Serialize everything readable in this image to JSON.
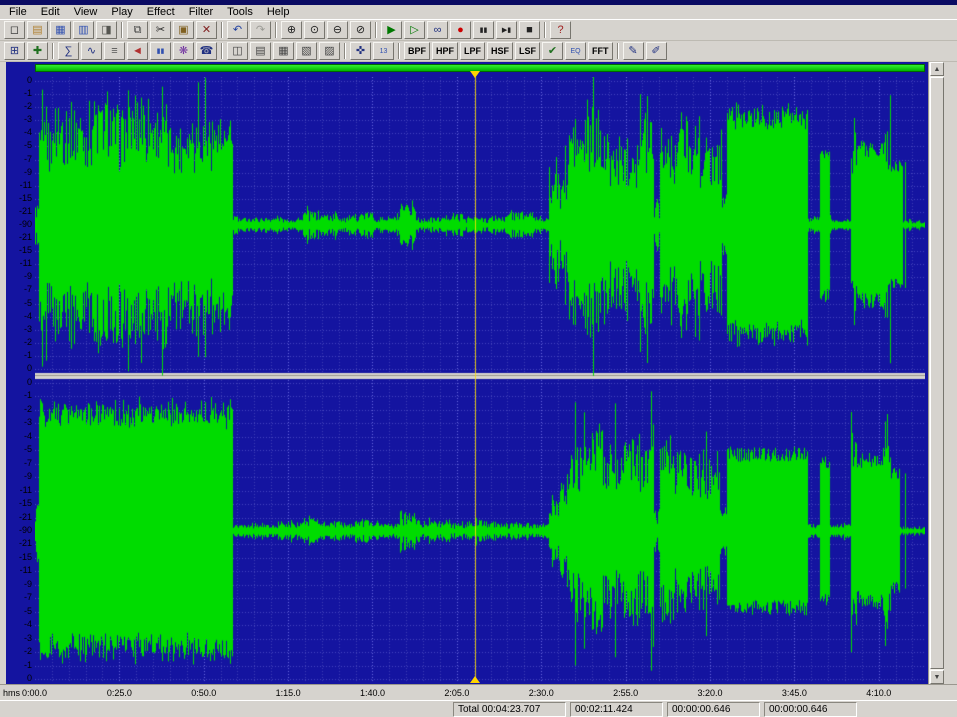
{
  "menu": {
    "items": [
      "File",
      "Edit",
      "View",
      "Play",
      "Effect",
      "Filter",
      "Tools",
      "Help"
    ]
  },
  "toolbar1": {
    "groups": [
      [
        {
          "n": "new",
          "g": "◻"
        },
        {
          "n": "open",
          "g": "▤",
          "c": "#b08030"
        },
        {
          "n": "save",
          "g": "▦",
          "c": "#3050b0"
        },
        {
          "n": "save-as",
          "g": "▥",
          "c": "#3050b0"
        },
        {
          "n": "file-info",
          "g": "◨",
          "c": "#555550"
        }
      ],
      [
        {
          "n": "copy",
          "g": "⧉",
          "c": "#444"
        },
        {
          "n": "cut",
          "g": "✂"
        },
        {
          "n": "paste",
          "g": "▣",
          "c": "#806020"
        },
        {
          "n": "delete",
          "g": "✕",
          "c": "#802020"
        }
      ],
      [
        {
          "n": "undo",
          "g": "↶",
          "c": "#2040a0"
        },
        {
          "n": "redo",
          "g": "↷",
          "c": "#9a9a94"
        }
      ],
      [
        {
          "n": "zoom-in",
          "g": "⊕"
        },
        {
          "n": "zoom-normal",
          "g": "⊙"
        },
        {
          "n": "zoom-out",
          "g": "⊖"
        },
        {
          "n": "zoom-selection",
          "g": "⊘"
        }
      ],
      [
        {
          "n": "play",
          "g": "▶",
          "c": "#007800"
        },
        {
          "n": "play-all",
          "g": "▷",
          "c": "#007800"
        },
        {
          "n": "loop",
          "g": "∞",
          "c": "#203080"
        },
        {
          "n": "record",
          "g": "●",
          "c": "#cc0000"
        },
        {
          "n": "pause",
          "g": "▮▮",
          "sm": true
        },
        {
          "n": "play-next",
          "g": "▶▮",
          "sm": true
        },
        {
          "n": "stop",
          "g": "■"
        }
      ],
      [
        {
          "n": "help-book",
          "g": "?",
          "c": "#a02020"
        }
      ]
    ]
  },
  "toolbar2": {
    "items": [
      {
        "n": "fit-window",
        "g": "⊞",
        "c": "#203080"
      },
      {
        "n": "marker-tool",
        "g": "✚",
        "c": "#207020"
      },
      {
        "sep": true
      },
      {
        "n": "statistics",
        "g": "∑",
        "c": "#203080"
      },
      {
        "n": "waveform-view",
        "g": "∿",
        "c": "#203080"
      },
      {
        "n": "device-controls",
        "g": "≡",
        "c": "#555"
      },
      {
        "n": "speaker",
        "g": "◄",
        "c": "#b03030"
      },
      {
        "n": "level-meters",
        "g": "▮▮",
        "c": "#3050b0",
        "sm": true
      },
      {
        "n": "effects-chain",
        "g": "❋",
        "c": "#7030a0"
      },
      {
        "n": "phone",
        "g": "☎",
        "c": "#203080"
      },
      {
        "sep": true
      },
      {
        "n": "control-window",
        "g": "◫",
        "c": "#444"
      },
      {
        "n": "expression-window",
        "g": "▤",
        "c": "#444"
      },
      {
        "n": "spectrum-window",
        "g": "▦",
        "c": "#444"
      },
      {
        "n": "bars-window",
        "g": "▧",
        "c": "#444"
      },
      {
        "n": "status-window",
        "g": "▨",
        "c": "#444"
      },
      {
        "sep": true
      },
      {
        "n": "snap-cursor",
        "g": "✜",
        "c": "#203080"
      },
      {
        "n": "channel-13",
        "g": "13",
        "c": "#3050b0",
        "sm": true
      },
      {
        "sep": true
      },
      {
        "n": "bpf-filter",
        "t": "BPF"
      },
      {
        "n": "hpf-filter",
        "t": "HPF"
      },
      {
        "n": "lpf-filter",
        "t": "LPF"
      },
      {
        "n": "hsf-filter",
        "t": "HSF"
      },
      {
        "n": "lsf-filter",
        "t": "LSF"
      },
      {
        "n": "noise-reduction",
        "g": "✔",
        "c": "#207020"
      },
      {
        "n": "equalizer",
        "g": "EQ",
        "c": "#3050b0",
        "sm": true
      },
      {
        "n": "fft-filter",
        "t": "FFT"
      },
      {
        "sep": true
      },
      {
        "n": "draw-wave",
        "g": "✎",
        "c": "#203080"
      },
      {
        "n": "draw-envelope",
        "g": "✐",
        "c": "#203080"
      }
    ]
  },
  "ruler": {
    "db_labels": [
      "0",
      "-1",
      "-2",
      "-3",
      "-4",
      "-5",
      "-7",
      "-9",
      "-11",
      "-15",
      "-21",
      "-90",
      "-21",
      "-15",
      "-11",
      "-9",
      "-7",
      "-5",
      "-4",
      "-3",
      "-2",
      "-1",
      "0"
    ]
  },
  "time_ruler": {
    "unit": "hms",
    "labels": [
      {
        "s": 0,
        "text": "0:00.0"
      },
      {
        "s": 25,
        "text": "0:25.0"
      },
      {
        "s": 50,
        "text": "0:50.0"
      },
      {
        "s": 75,
        "text": "1:15.0"
      },
      {
        "s": 100,
        "text": "1:40.0"
      },
      {
        "s": 125,
        "text": "2:05.0"
      },
      {
        "s": 150,
        "text": "2:30.0"
      },
      {
        "s": 175,
        "text": "2:55.0"
      },
      {
        "s": 200,
        "text": "3:20.0"
      },
      {
        "s": 225,
        "text": "3:45.0"
      },
      {
        "s": 250,
        "text": "4:10.0"
      }
    ]
  },
  "waveform": {
    "total_seconds": 263.707,
    "bg": "#1414a0",
    "grid_minor": "#3d3db4",
    "grid_major": "#6a6ae0",
    "grid_horizontal": "#4646c0",
    "green": "#00dc00",
    "channels": [
      {
        "seed": 1,
        "segments": [
          [
            0.0,
            0.004,
            0.05,
            0.2,
            "noisy"
          ],
          [
            0.004,
            0.222,
            0.45,
            0.95,
            "noisy"
          ],
          [
            0.222,
            0.228,
            0.03,
            0.1,
            "noisy"
          ],
          [
            0.228,
            0.3,
            0.02,
            0.06,
            "noisy"
          ],
          [
            0.3,
            0.32,
            0.03,
            0.13,
            "noisy"
          ],
          [
            0.32,
            0.36,
            0.02,
            0.09,
            "noisy"
          ],
          [
            0.36,
            0.38,
            0.03,
            0.1,
            "noisy"
          ],
          [
            0.38,
            0.41,
            0.02,
            0.07,
            "noisy"
          ],
          [
            0.41,
            0.428,
            0.04,
            0.16,
            "noisy"
          ],
          [
            0.428,
            0.46,
            0.02,
            0.07,
            "noisy"
          ],
          [
            0.46,
            0.48,
            0.03,
            0.1,
            "noisy"
          ],
          [
            0.48,
            0.53,
            0.02,
            0.08,
            "noisy"
          ],
          [
            0.53,
            0.56,
            0.03,
            0.1,
            "noisy"
          ],
          [
            0.56,
            0.578,
            0.02,
            0.06,
            "noisy"
          ],
          [
            0.578,
            0.6,
            0.15,
            0.55,
            "noisy"
          ],
          [
            0.6,
            0.695,
            0.35,
            0.85,
            "noisy"
          ],
          [
            0.695,
            0.702,
            0.05,
            0.2,
            "noisy"
          ],
          [
            0.702,
            0.772,
            0.35,
            0.8,
            "noisy"
          ],
          [
            0.772,
            0.778,
            0.1,
            0.3,
            "noisy"
          ],
          [
            0.778,
            0.868,
            0.6,
            0.8,
            "dense"
          ],
          [
            0.868,
            0.882,
            0.02,
            0.06,
            "noisy"
          ],
          [
            0.882,
            0.893,
            0.45,
            0.55,
            "solid"
          ],
          [
            0.893,
            0.917,
            0.02,
            0.05,
            "noisy"
          ],
          [
            0.917,
            0.924,
            0.5,
            0.9,
            "noisy"
          ],
          [
            0.924,
            0.955,
            0.45,
            0.62,
            "solid"
          ],
          [
            0.955,
            0.962,
            0.5,
            0.95,
            "noisy"
          ],
          [
            0.962,
            0.975,
            0.3,
            0.52,
            "solid"
          ],
          [
            0.975,
            1.0,
            0.01,
            0.04,
            "noisy"
          ]
        ],
        "spikes": [
          [
            0.978,
            0.45
          ]
        ]
      },
      {
        "seed": 2,
        "segments": [
          [
            0.0,
            0.004,
            0.05,
            0.3,
            "noisy"
          ],
          [
            0.004,
            0.222,
            0.6,
            0.85,
            "dense"
          ],
          [
            0.222,
            0.3,
            0.02,
            0.06,
            "noisy"
          ],
          [
            0.3,
            0.32,
            0.03,
            0.12,
            "noisy"
          ],
          [
            0.32,
            0.36,
            0.02,
            0.08,
            "noisy"
          ],
          [
            0.36,
            0.385,
            0.03,
            0.1,
            "noisy"
          ],
          [
            0.385,
            0.41,
            0.02,
            0.07,
            "noisy"
          ],
          [
            0.41,
            0.428,
            0.04,
            0.17,
            "noisy"
          ],
          [
            0.428,
            0.48,
            0.02,
            0.08,
            "noisy"
          ],
          [
            0.48,
            0.53,
            0.02,
            0.09,
            "noisy"
          ],
          [
            0.53,
            0.578,
            0.02,
            0.07,
            "noisy"
          ],
          [
            0.578,
            0.6,
            0.12,
            0.45,
            "noisy"
          ],
          [
            0.6,
            0.695,
            0.3,
            0.75,
            "noisy"
          ],
          [
            0.695,
            0.702,
            0.05,
            0.2,
            "noisy"
          ],
          [
            0.702,
            0.77,
            0.3,
            0.7,
            "noisy"
          ],
          [
            0.77,
            0.778,
            0.05,
            0.2,
            "noisy"
          ],
          [
            0.778,
            0.868,
            0.5,
            0.56,
            "solid"
          ],
          [
            0.868,
            0.882,
            0.02,
            0.05,
            "noisy"
          ],
          [
            0.882,
            0.893,
            0.45,
            0.5,
            "solid"
          ],
          [
            0.893,
            0.917,
            0.02,
            0.05,
            "noisy"
          ],
          [
            0.917,
            0.926,
            0.5,
            0.85,
            "noisy"
          ],
          [
            0.926,
            0.953,
            0.4,
            0.56,
            "solid"
          ],
          [
            0.953,
            0.962,
            0.5,
            0.9,
            "noisy"
          ],
          [
            0.962,
            0.972,
            0.3,
            0.46,
            "solid"
          ],
          [
            0.972,
            1.0,
            0.01,
            0.04,
            "noisy"
          ]
        ],
        "spikes": [
          [
            0.692,
            0.97
          ],
          [
            0.978,
            0.4
          ]
        ]
      }
    ]
  },
  "playhead": {
    "frac": 0.494,
    "color": "#ffe000"
  },
  "status": {
    "boxes": [
      "Total 00:04:23.707",
      "00:02:11.424",
      "00:00:00.646",
      "00:00:00.646"
    ]
  }
}
